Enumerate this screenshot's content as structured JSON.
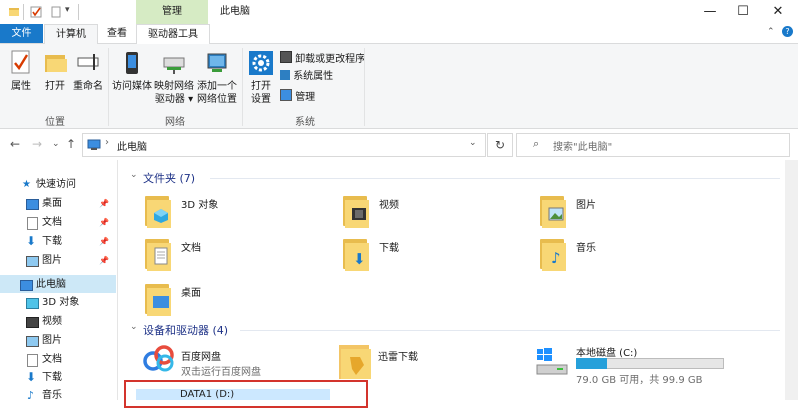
{
  "window": {
    "title": "此电脑",
    "contextual_tab_group": "管理",
    "controls": [
      "—",
      "☐",
      "✕"
    ]
  },
  "ribbon_tabs": [
    "文件",
    "计算机",
    "查看",
    "驱动器工具"
  ],
  "ribbon": {
    "location_group": {
      "label": "位置",
      "buttons": [
        "属性",
        "打开",
        "重命名"
      ]
    },
    "network_group": {
      "label": "网络",
      "buttons": [
        {
          "line1": "访问媒体",
          "line2": ""
        },
        {
          "line1": "映射网络",
          "line2": "驱动器"
        },
        {
          "line1": "添加一个",
          "line2": "网络位置"
        }
      ]
    },
    "system_group": {
      "label": "系统",
      "open_settings": {
        "line1": "打开",
        "line2": "设置"
      },
      "small_items": [
        "卸载或更改程序",
        "系统属性",
        "管理"
      ]
    }
  },
  "address": {
    "path": "此电脑",
    "search_placeholder": "搜索\"此电脑\""
  },
  "nav_pane": {
    "quick_access": "快速访问",
    "quick_items": [
      "桌面",
      "文档",
      "下载",
      "图片"
    ],
    "this_pc": "此电脑",
    "pc_items": [
      "3D 对象",
      "视频",
      "图片",
      "文档",
      "下载",
      "音乐"
    ]
  },
  "folders_section": {
    "header": "文件夹 (7)",
    "items": [
      "3D 对象",
      "视频",
      "图片",
      "文档",
      "下载",
      "音乐",
      "桌面"
    ]
  },
  "devices_section": {
    "header": "设备和驱动器 (4)",
    "baidu": {
      "name": "百度网盘",
      "sub": "双击运行百度网盘"
    },
    "xunlei": {
      "name": "迅雷下载"
    },
    "local_disk": {
      "name": "本地磁盘 (C:)",
      "free_text": "79.0 GB 可用，共 99.9 GB",
      "used_fraction": 0.21
    },
    "data1": {
      "name": "DATA1 (D:)"
    }
  },
  "colors": {
    "accent": "#1979ca",
    "manage_tab": "#d6ebc4",
    "selection": "#cde8f7",
    "capacity_bar": "#26a0da",
    "highlight_box": "#d3342d"
  }
}
